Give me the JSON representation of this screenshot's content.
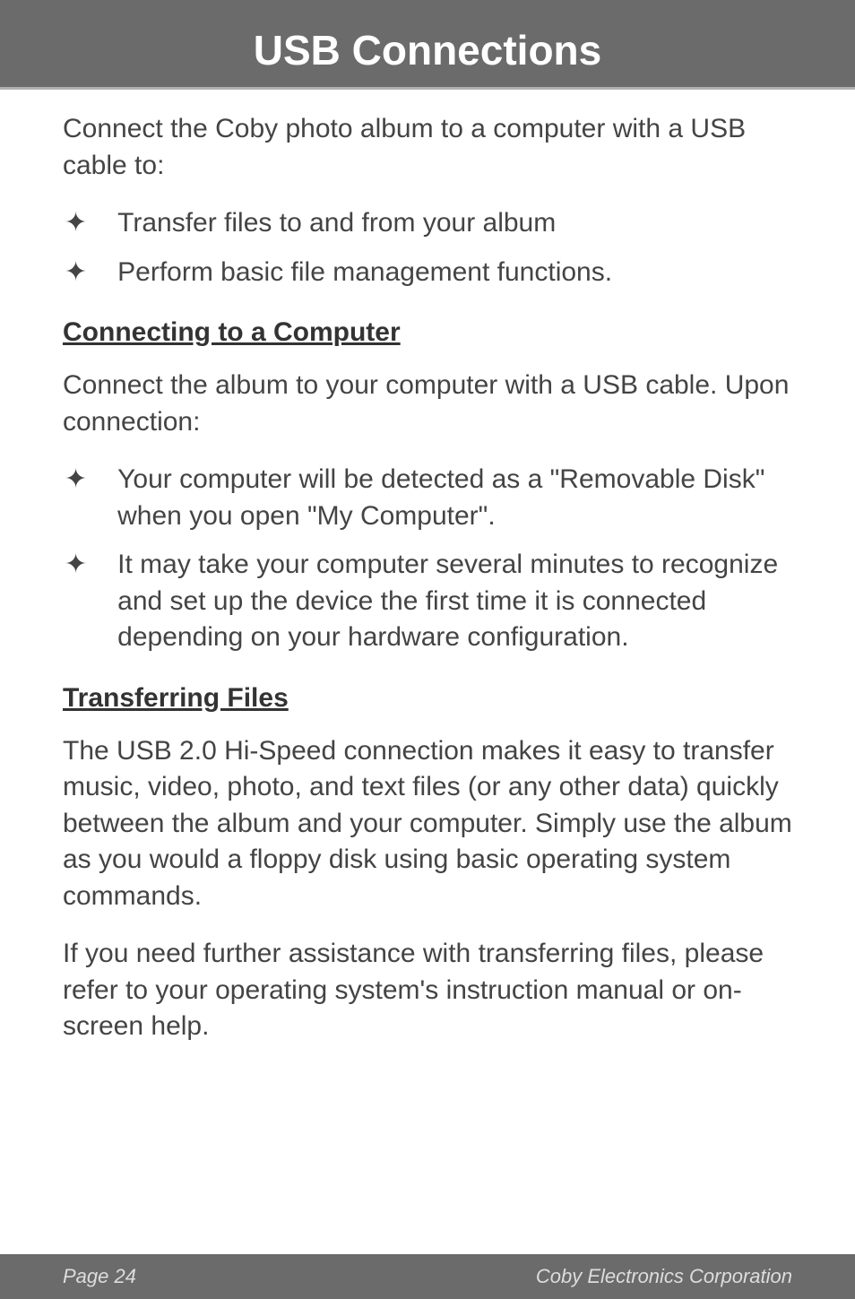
{
  "header": {
    "title": "USB Connections"
  },
  "intro": "Connect the Coby photo album to a computer with a USB cable to:",
  "bullets1": [
    "Transfer files to and from your album",
    "Perform basic file management functions."
  ],
  "section1": {
    "heading": "Connecting to a Computer",
    "para": "Connect the album to your computer with a USB cable. Upon connection:",
    "bullets": [
      "Your computer will be detected as a \"Removable Disk\" when you open \"My Computer\".",
      "It may take your computer several minutes to recognize and set up the device the first time it is connected depending on your hardware configuration."
    ]
  },
  "section2": {
    "heading": "Transferring Files",
    "para1": "The USB 2.0 Hi-Speed connection makes it easy to transfer music, video, photo, and text files (or any other data) quickly between the album and your computer. Simply use the album as you would a floppy disk using basic operating system commands.",
    "para2": "If you need further assistance with transferring files, please refer to your operating system's instruction manual or on-screen help."
  },
  "footer": {
    "page": "Page 24",
    "company": "Coby Electronics Corporation"
  }
}
